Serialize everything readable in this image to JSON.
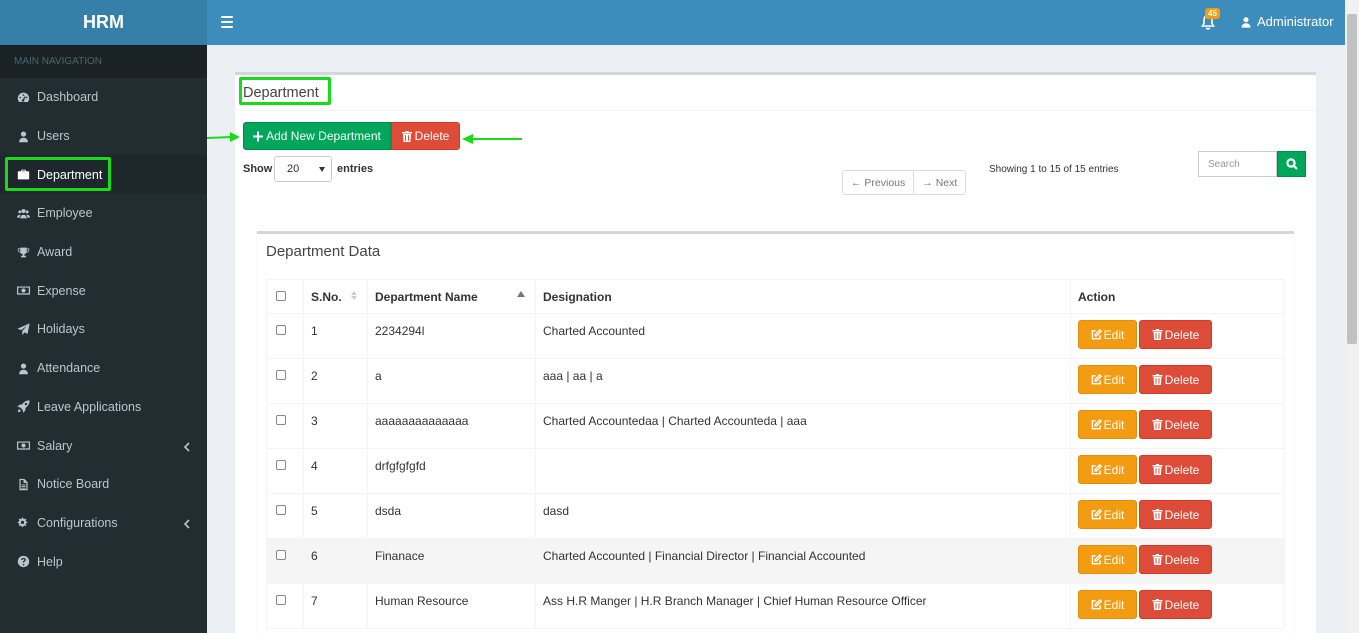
{
  "app": {
    "logo": "HRM"
  },
  "header": {
    "notification_count": "45",
    "user_name": "Administrator"
  },
  "sidebar": {
    "header": "MAIN NAVIGATION",
    "items": [
      {
        "label": "Dashboard",
        "icon": "dashboard-icon"
      },
      {
        "label": "Users",
        "icon": "user-icon"
      },
      {
        "label": "Department",
        "icon": "briefcase-icon",
        "active": true
      },
      {
        "label": "Employee",
        "icon": "users-icon"
      },
      {
        "label": "Award",
        "icon": "trophy-icon"
      },
      {
        "label": "Expense",
        "icon": "money-icon"
      },
      {
        "label": "Holidays",
        "icon": "paper-plane-icon"
      },
      {
        "label": "Attendance",
        "icon": "user-icon"
      },
      {
        "label": "Leave Applications",
        "icon": "rocket-icon"
      },
      {
        "label": "Salary",
        "icon": "money-icon",
        "has_submenu": true
      },
      {
        "label": "Notice Board",
        "icon": "file-icon"
      },
      {
        "label": "Configurations",
        "icon": "cogs-icon",
        "has_submenu": true
      },
      {
        "label": "Help",
        "icon": "question-icon"
      }
    ]
  },
  "page": {
    "title": "Department",
    "add_button": "Add New Department",
    "delete_button": "Delete",
    "show_label": "Show",
    "entries_value": "20",
    "entries_label": "entries",
    "pager": {
      "previous": "← Previous",
      "next": "→ Next"
    },
    "showing_text": "Showing 1 to 15 of 15 entries",
    "search_placeholder": "Search"
  },
  "table": {
    "title": "Department Data",
    "columns": [
      "S.No.",
      "Department Name",
      "Designation",
      "Action"
    ],
    "edit_label": "Edit",
    "delete_label": "Delete",
    "rows": [
      {
        "sno": "1",
        "name": "2234294l",
        "designation": "Charted Accounted"
      },
      {
        "sno": "2",
        "name": "a",
        "designation": "aaa | aa | a"
      },
      {
        "sno": "3",
        "name": "aaaaaaaaaaaaaa",
        "designation": "Charted Accountedaa | Charted Accounteda | aaa"
      },
      {
        "sno": "4",
        "name": "drfgfgfgfd",
        "designation": ""
      },
      {
        "sno": "5",
        "name": "dsda",
        "designation": "dasd"
      },
      {
        "sno": "6",
        "name": "Finanace",
        "designation": "Charted Accounted | Financial Director | Financial Accounted"
      },
      {
        "sno": "7",
        "name": "Human Resource",
        "designation": "Ass H.R Manger | H.R Branch Manager | Chief Human Resource Officer"
      }
    ]
  },
  "colors": {
    "sidebar": "#222d32",
    "header": "#3c8dbc",
    "add": "#00a65a",
    "delete": "#dd4b39",
    "edit": "#f39c12",
    "highlight": "#1adb1a"
  }
}
